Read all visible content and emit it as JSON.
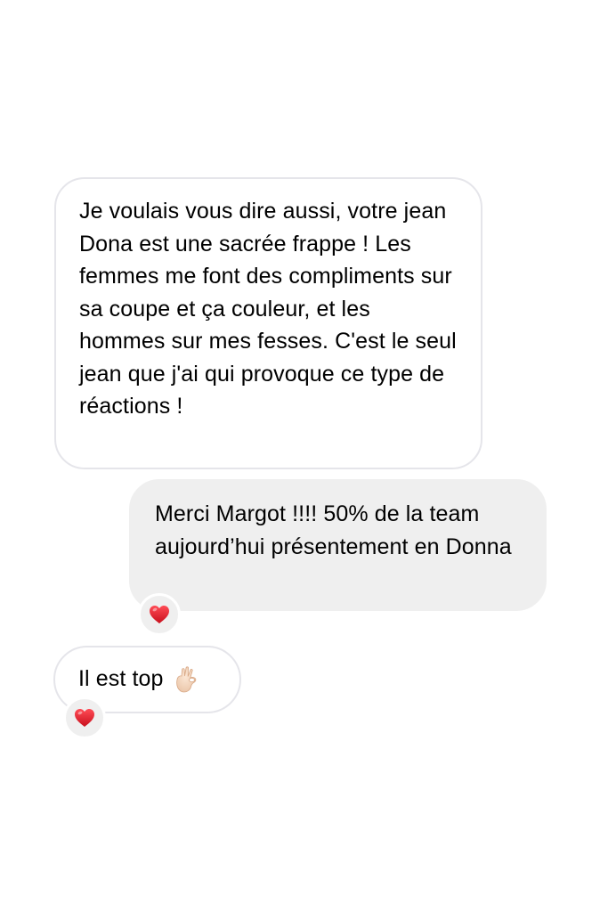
{
  "conversation": {
    "messages": [
      {
        "direction": "received",
        "text": "Je voulais vous dire aussi, votre jean Dona est une sacrée frappe ! Les femmes me font des compliments sur sa coupe et ça couleur, et les hommes sur mes fesses. C'est le seul jean que j'ai qui provoque ce type de réactions !"
      },
      {
        "direction": "sent",
        "text": "Merci Margot !!!! 50% de la team aujourd’hui présentement en Donna",
        "reaction": "heart-icon"
      },
      {
        "direction": "received",
        "text": "Il est top",
        "emoji": "ok-hand-icon",
        "reaction": "heart-icon"
      }
    ]
  },
  "colors": {
    "received_border": "#e5e5ea",
    "sent_background": "#efefef",
    "heart": "#e0262f",
    "text": "#000000"
  }
}
